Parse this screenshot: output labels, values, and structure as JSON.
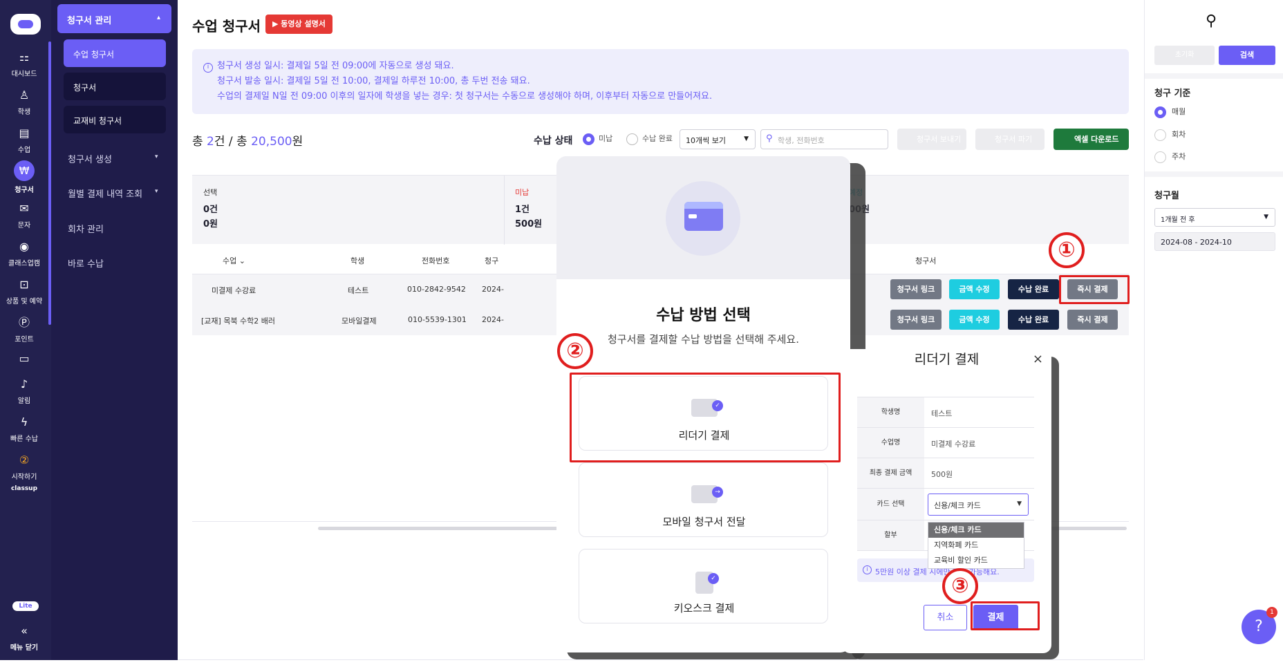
{
  "rail": {
    "items": [
      {
        "label": "대시보드",
        "icon": "⚏"
      },
      {
        "label": "학생",
        "icon": "♙"
      },
      {
        "label": "수업",
        "icon": "▤"
      },
      {
        "label": "청구서",
        "icon": "₩"
      },
      {
        "label": "문자",
        "icon": "✉"
      },
      {
        "label": "클래스업캠",
        "icon": "◉"
      },
      {
        "label": "상품 및 예약",
        "icon": "⊡"
      },
      {
        "label": "포인트",
        "icon": "Ⓟ"
      },
      {
        "label": "",
        "icon": "▭"
      },
      {
        "label": "알림",
        "icon": "♪"
      },
      {
        "label": "빠른 수납",
        "icon": "ϟ"
      },
      {
        "label": "시작하기",
        "icon": "②"
      }
    ],
    "brand": "classup",
    "brand_badge": "Lite",
    "collapse_label": "메뉴 닫기",
    "collapse_icon": "«"
  },
  "subnav": {
    "group_title": "청구서 관리",
    "group_caret": "▴",
    "sub_items": [
      "수업 청구서",
      "청구서",
      "교재비 청구서"
    ],
    "menus": [
      {
        "label": "청구서 생성",
        "caret": "▾"
      },
      {
        "label": "월별 결제 내역 조회",
        "caret": "▾"
      },
      {
        "label": "회차 관리",
        "caret": ""
      },
      {
        "label": "바로 수납",
        "caret": ""
      }
    ]
  },
  "main": {
    "title": "수업 청구서",
    "video_button": "▶ 동영상 설명서",
    "info_icon": "i",
    "info_lines": [
      "청구서 생성 일시: 결제일 5일 전 09:00에 자동으로 생성 돼요.",
      "청구서 발송 일시: 결제일 5일 전 10:00, 결제일 하루전 10:00, 총 두번 전송 돼요.",
      "수업의 결제일 N일 전 09:00 이후의 일자에 학생을 넣는 경우: 첫 청구서는 수동으로 생성해야 하며, 이후부터 자동으로 만들어져요."
    ],
    "totals": {
      "prefix": "총 ",
      "count": "2",
      "mid": "건 / 총 ",
      "amount": "20,500",
      "suffix": "원"
    },
    "status_label": "수납 상태",
    "status_options": [
      "미납",
      "수납 완료"
    ],
    "page_size": "10개씩 보기",
    "search_placeholder": "학생, 전화번호",
    "send_button": "청구서 보내기",
    "delete_button": "청구서 파기",
    "excel_button": "엑셀 다운로드",
    "summary": [
      {
        "label": "선택",
        "count": "0건",
        "amount": "0원"
      },
      {
        "label": "미납",
        "count": "1건",
        "amount": "500원"
      },
      {
        "label": "예정",
        "count": "",
        "amount": "00원"
      }
    ],
    "columns": [
      "수업",
      "학생",
      "전화번호",
      "청구",
      "청구서"
    ],
    "rows": [
      {
        "course": "미결제 수강료",
        "student": "테스트",
        "phone": "010-2842-9542",
        "date": "2024-"
      },
      {
        "course": "[교재] 목북 수학2 배러",
        "student": "모바일결제",
        "phone": "010-5539-1301",
        "date": "2024-"
      }
    ],
    "row_buttons": [
      "청구서 링크",
      "금액 수정",
      "수납 완료",
      "즉시 결제"
    ]
  },
  "filter": {
    "search_icon": "⚲",
    "reset": "초기화",
    "search": "검색",
    "basis_title": "청구 기준",
    "basis_options": [
      "매월",
      "회차",
      "주차"
    ],
    "month_title": "청구월",
    "month_select": "1개월 전 후",
    "month_range": "2024-08 - 2024-10"
  },
  "modal_method": {
    "title": "수납 방법 선택",
    "subtitle": "청구서를 결제할 수납 방법을 선택해 주세요.",
    "options": [
      "리더기 결제",
      "모바일 청구서 전달",
      "키오스크 결제"
    ]
  },
  "modal_reader": {
    "title": "리더기 결제",
    "close": "×",
    "fields": [
      {
        "key": "학생명",
        "value": "테스트"
      },
      {
        "key": "수업명",
        "value": "미결제 수강료"
      },
      {
        "key": "최종 결제 금액",
        "value": "500원"
      },
      {
        "key": "카드 선택",
        "value": "신용/체크 카드"
      },
      {
        "key": "할부",
        "value": ""
      }
    ],
    "card_options": [
      "신용/체크 카드",
      "지역화폐 카드",
      "교육비 할인 카드"
    ],
    "note": "5만원 이상 결제 시에만 할부 가능해요.",
    "cancel": "취소",
    "pay": "결제"
  },
  "annotations": [
    "①",
    "②",
    "③"
  ],
  "help": {
    "icon": "?",
    "badge": "1"
  },
  "colors": {
    "accent": "#6b5ef5",
    "rail": "#23214f",
    "annotation": "#e01e1e",
    "excel": "#1e7a3c"
  }
}
